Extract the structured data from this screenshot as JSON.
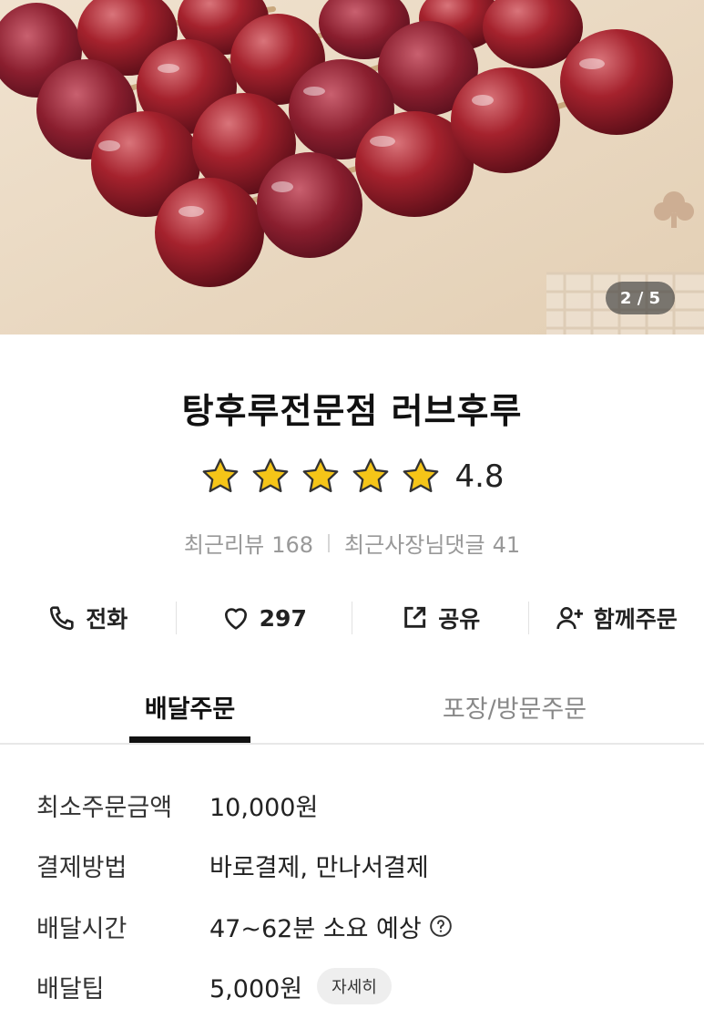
{
  "hero": {
    "image_subject": "candied grape skewers (tanghulu) on wooden board",
    "page_indicator": "2 / 5"
  },
  "store": {
    "name": "탕후루전문점 러브후루",
    "rating": "4.8",
    "star_count": 5,
    "star_color": "#f5c518",
    "recent_reviews_label": "최근리뷰",
    "recent_reviews_count": "168",
    "owner_replies_label": "최근사장님댓글",
    "owner_replies_count": "41"
  },
  "actions": {
    "call_label": "전화",
    "like_count": "297",
    "share_label": "공유",
    "group_order_label": "함께주문"
  },
  "tabs": {
    "delivery_label": "배달주문",
    "takeout_label": "포장/방문주문",
    "active": "delivery"
  },
  "info": {
    "min_order_label": "최소주문금액",
    "min_order_value": "10,000원",
    "payment_label": "결제방법",
    "payment_value": "바로결제, 만나서결제",
    "delivery_time_label": "배달시간",
    "delivery_time_value": "47~62분 소요 예상",
    "delivery_tip_label": "배달팁",
    "delivery_tip_value": "5,000원",
    "detail_button_label": "자세히"
  }
}
